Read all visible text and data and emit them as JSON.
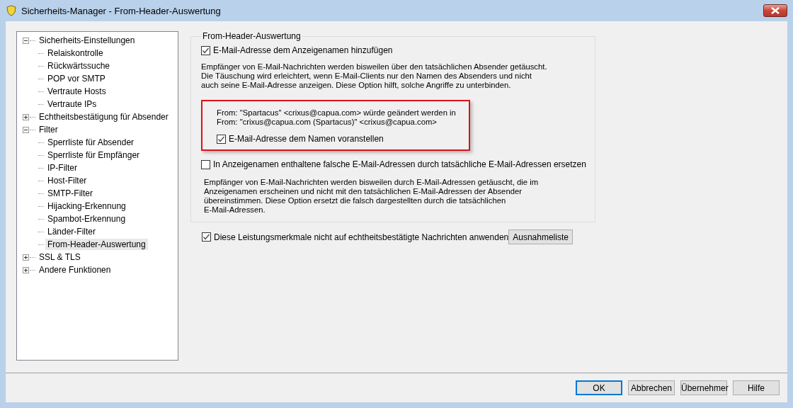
{
  "window": {
    "title": "Sicherheits-Manager - From-Header-Auswertung"
  },
  "tree": [
    {
      "label": "Sicherheits-Einstellungen",
      "expanded": true,
      "selected": false,
      "children": [
        {
          "label": "Relaiskontrolle",
          "selected": false
        },
        {
          "label": "Rückwärtssuche",
          "selected": false
        },
        {
          "label": "POP vor SMTP",
          "selected": false
        },
        {
          "label": "Vertraute Hosts",
          "selected": false
        },
        {
          "label": "Vertraute IPs",
          "selected": false
        }
      ]
    },
    {
      "label": "Echtheitsbestätigung für Absender",
      "expanded": false,
      "selected": false
    },
    {
      "label": "Filter",
      "expanded": true,
      "selected": false,
      "children": [
        {
          "label": "Sperrliste für Absender",
          "selected": false
        },
        {
          "label": "Sperrliste für Empfänger",
          "selected": false
        },
        {
          "label": "IP-Filter",
          "selected": false
        },
        {
          "label": "Host-Filter",
          "selected": false
        },
        {
          "label": "SMTP-Filter",
          "selected": false
        },
        {
          "label": "Hijacking-Erkennung",
          "selected": false
        },
        {
          "label": "Spambot-Erkennung",
          "selected": false
        },
        {
          "label": "Länder-Filter",
          "selected": false
        },
        {
          "label": "From-Header-Auswertung",
          "selected": true
        }
      ]
    },
    {
      "label": "SSL & TLS",
      "expanded": false,
      "selected": false
    },
    {
      "label": "Andere Funktionen",
      "expanded": false,
      "selected": false
    }
  ],
  "group": {
    "title": "From-Header-Auswertung",
    "option_1": {
      "label": "E-Mail-Adresse dem Anzeigenamen hinzufügen",
      "checked": true
    },
    "description_1": [
      "Empfänger von E-Mail-Nachrichten werden bisweilen über den tatsächlichen Absender getäuscht.",
      "Die Täuschung wird erleichtert, wenn E-Mail-Clients nur den Namen des Absenders und nicht",
      "auch seine E-Mail-Adresse anzeigen. Diese Option hilft, solche Angriffe zu unterbinden."
    ],
    "example": [
      "From: \"Spartacus\" <crixus@capua.com> würde geändert werden in",
      "From: \"crixus@capua.com (Spartacus)\" <crixus@capua.com>"
    ],
    "option_2": {
      "label": "E-Mail-Adresse dem Namen voranstellen",
      "checked": true
    },
    "option_3": {
      "label": "In Anzeigenamen enthaltene falsche E-Mail-Adressen durch tatsächliche E-Mail-Adressen ersetzen",
      "checked": false
    },
    "description_2": [
      "Empfänger von E-Mail-Nachrichten werden bisweilen durch E-Mail-Adressen getäuscht, die im",
      "Anzeigenamen erscheinen und nicht mit den tatsächlichen E-Mail-Adressen der Absender",
      "übereinstimmen. Diese Option ersetzt die falsch dargestellten durch die tatsächlichen",
      "E-Mail-Adressen."
    ]
  },
  "option_4": {
    "label": "Diese Leistungsmerkmale nicht auf echtheitsbestätigte Nachrichten anwenden",
    "checked": true
  },
  "exceptions_button": "Ausnahmeliste",
  "buttons": [
    {
      "label": "OK",
      "default": true
    },
    {
      "label": "Abbrechen",
      "default": false
    },
    {
      "label": "Übernehmer",
      "default": false
    },
    {
      "label": "Hilfe",
      "default": false
    }
  ]
}
